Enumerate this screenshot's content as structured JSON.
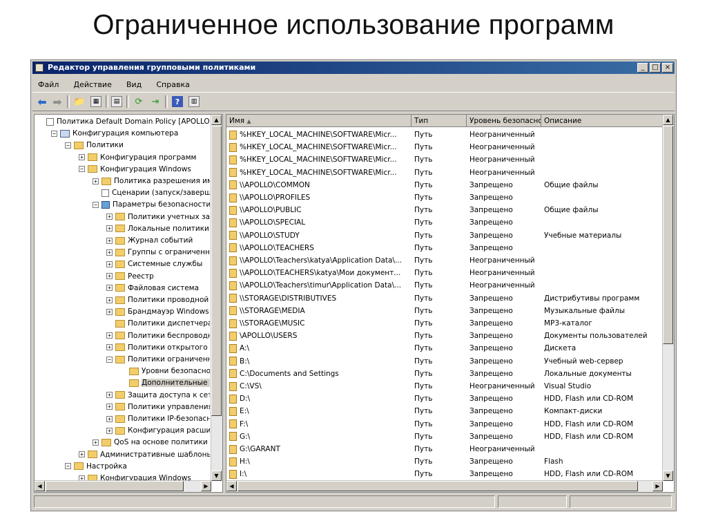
{
  "slide": {
    "title": "Ограниченное использование программ"
  },
  "window": {
    "title": "Редактор управления групповыми политиками",
    "controls": {
      "minimize": "_",
      "maximize": "□",
      "close": "×"
    }
  },
  "menu": [
    "Файл",
    "Действие",
    "Вид",
    "Справка"
  ],
  "toolbar": [
    "back-arrow-icon",
    "forward-arrow-icon",
    "up-folder-icon",
    "show-hide-tree-icon",
    "properties-icon",
    "refresh-icon",
    "export-list-icon",
    "help-icon",
    "view-icon"
  ],
  "tree": [
    {
      "label": "Политика Default Domain Policy [APOLLO.GOV",
      "icon": "doc",
      "indent": 0,
      "expander": ""
    },
    {
      "label": "Конфигурация компьютера",
      "icon": "pc",
      "indent": 1,
      "expander": "−"
    },
    {
      "label": "Политики",
      "icon": "folder",
      "indent": 2,
      "expander": "−"
    },
    {
      "label": "Конфигурация программ",
      "icon": "folder",
      "indent": 3,
      "expander": "+"
    },
    {
      "label": "Конфигурация Windows",
      "icon": "folder",
      "indent": 3,
      "expander": "−"
    },
    {
      "label": "Политика разрешения имен",
      "icon": "folder",
      "indent": 4,
      "expander": "+"
    },
    {
      "label": "Сценарии (запуск/завершение)",
      "icon": "doc",
      "indent": 4,
      "expander": ""
    },
    {
      "label": "Параметры безопасности",
      "icon": "shield",
      "indent": 4,
      "expander": "−"
    },
    {
      "label": "Политики учетных записей",
      "icon": "folder",
      "indent": 5,
      "expander": "+"
    },
    {
      "label": "Локальные политики",
      "icon": "folder",
      "indent": 5,
      "expander": "+"
    },
    {
      "label": "Журнал событий",
      "icon": "folder",
      "indent": 5,
      "expander": "+"
    },
    {
      "label": "Группы с ограниченным доступом",
      "icon": "folder",
      "indent": 5,
      "expander": "+"
    },
    {
      "label": "Системные службы",
      "icon": "folder",
      "indent": 5,
      "expander": "+"
    },
    {
      "label": "Реестр",
      "icon": "folder",
      "indent": 5,
      "expander": "+"
    },
    {
      "label": "Файловая система",
      "icon": "folder",
      "indent": 5,
      "expander": "+"
    },
    {
      "label": "Политики проводной сети",
      "icon": "folder",
      "indent": 5,
      "expander": "+"
    },
    {
      "label": "Брандмауэр Windows в режиме",
      "icon": "folder",
      "indent": 5,
      "expander": "+"
    },
    {
      "label": "Политики диспетчера списка",
      "icon": "folder",
      "indent": 5,
      "expander": ""
    },
    {
      "label": "Политики беспроводной сети",
      "icon": "folder",
      "indent": 5,
      "expander": "+"
    },
    {
      "label": "Политики открытого ключа",
      "icon": "folder",
      "indent": 5,
      "expander": "+"
    },
    {
      "label": "Политики ограниченного использования",
      "icon": "folder",
      "indent": 5,
      "expander": "−"
    },
    {
      "label": "Уровни безопасности",
      "icon": "folder",
      "indent": 6,
      "expander": ""
    },
    {
      "label": "Дополнительные правила",
      "icon": "folder",
      "indent": 6,
      "expander": "",
      "selected": true
    },
    {
      "label": "Защита доступа к сети",
      "icon": "folder",
      "indent": 5,
      "expander": "+"
    },
    {
      "label": "Политики управления приложениями",
      "icon": "folder",
      "indent": 5,
      "expander": "+"
    },
    {
      "label": "Политики IP-безопасности",
      "icon": "folder",
      "indent": 5,
      "expander": "+"
    },
    {
      "label": "Конфигурация расширенной",
      "icon": "folder",
      "indent": 5,
      "expander": "+"
    },
    {
      "label": "QoS на основе политики",
      "icon": "folder",
      "indent": 4,
      "expander": "+"
    },
    {
      "label": "Административные шаблоны:",
      "icon": "folder",
      "indent": 3,
      "expander": "+"
    },
    {
      "label": "Настройка",
      "icon": "folder",
      "indent": 2,
      "expander": "−"
    },
    {
      "label": "Конфигурация Windows",
      "icon": "folder",
      "indent": 3,
      "expander": "+"
    }
  ],
  "list": {
    "columns": [
      "Имя",
      "Тип",
      "Уровень безопасности",
      "Описание"
    ],
    "rows": [
      {
        "name": "%HKEY_LOCAL_MACHINE\\SOFTWARE\\Micr...",
        "type": "Путь",
        "level": "Неограниченный",
        "desc": ""
      },
      {
        "name": "%HKEY_LOCAL_MACHINE\\SOFTWARE\\Micr...",
        "type": "Путь",
        "level": "Неограниченный",
        "desc": ""
      },
      {
        "name": "%HKEY_LOCAL_MACHINE\\SOFTWARE\\Micr...",
        "type": "Путь",
        "level": "Неограниченный",
        "desc": ""
      },
      {
        "name": "%HKEY_LOCAL_MACHINE\\SOFTWARE\\Micr...",
        "type": "Путь",
        "level": "Неограниченный",
        "desc": ""
      },
      {
        "name": "\\\\APOLLO\\COMMON",
        "type": "Путь",
        "level": "Запрещено",
        "desc": "Общие файлы"
      },
      {
        "name": "\\\\APOLLO\\PROFILES",
        "type": "Путь",
        "level": "Запрещено",
        "desc": ""
      },
      {
        "name": "\\\\APOLLO\\PUBLIC",
        "type": "Путь",
        "level": "Запрещено",
        "desc": "Общие файлы"
      },
      {
        "name": "\\\\APOLLO\\SPECIAL",
        "type": "Путь",
        "level": "Запрещено",
        "desc": ""
      },
      {
        "name": "\\\\APOLLO\\STUDY",
        "type": "Путь",
        "level": "Запрещено",
        "desc": "Учебные материалы"
      },
      {
        "name": "\\\\APOLLO\\TEACHERS",
        "type": "Путь",
        "level": "Запрещено",
        "desc": ""
      },
      {
        "name": "\\\\APOLLO\\Teachers\\katya\\Application Data\\...",
        "type": "Путь",
        "level": "Неограниченный",
        "desc": ""
      },
      {
        "name": "\\\\APOLLO\\TEACHERS\\katya\\Мои документ...",
        "type": "Путь",
        "level": "Неограниченный",
        "desc": ""
      },
      {
        "name": "\\\\APOLLO\\Teachers\\timur\\Application Data\\...",
        "type": "Путь",
        "level": "Неограниченный",
        "desc": ""
      },
      {
        "name": "\\\\STORAGE\\DISTRIBUTIVES",
        "type": "Путь",
        "level": "Запрещено",
        "desc": "Дистрибутивы программ"
      },
      {
        "name": "\\\\STORAGE\\MEDIA",
        "type": "Путь",
        "level": "Запрещено",
        "desc": "Музыкальные файлы"
      },
      {
        "name": "\\\\STORAGE\\MUSIC",
        "type": "Путь",
        "level": "Запрещено",
        "desc": "MP3-каталог"
      },
      {
        "name": "\\APOLLO\\USERS",
        "type": "Путь",
        "level": "Запрещено",
        "desc": "Документы пользователей"
      },
      {
        "name": "A:\\",
        "type": "Путь",
        "level": "Запрещено",
        "desc": "Дискета"
      },
      {
        "name": "B:\\",
        "type": "Путь",
        "level": "Запрещено",
        "desc": "Учебный web-сервер"
      },
      {
        "name": "C:\\Documents and Settings",
        "type": "Путь",
        "level": "Запрещено",
        "desc": "Локальные документы"
      },
      {
        "name": "C:\\VS\\",
        "type": "Путь",
        "level": "Неограниченный",
        "desc": "Visual Studio"
      },
      {
        "name": "D:\\",
        "type": "Путь",
        "level": "Запрещено",
        "desc": "HDD, Flash или CD-ROM"
      },
      {
        "name": "E:\\",
        "type": "Путь",
        "level": "Запрещено",
        "desc": "Компакт-диски"
      },
      {
        "name": "F:\\",
        "type": "Путь",
        "level": "Запрещено",
        "desc": "HDD, Flash или CD-ROM"
      },
      {
        "name": "G:\\",
        "type": "Путь",
        "level": "Запрещено",
        "desc": "HDD, Flash или CD-ROM"
      },
      {
        "name": "G:\\GARANT",
        "type": "Путь",
        "level": "Неограниченный",
        "desc": ""
      },
      {
        "name": "H:\\",
        "type": "Путь",
        "level": "Запрещено",
        "desc": "Flash"
      },
      {
        "name": "I:\\",
        "type": "Путь",
        "level": "Запрещено",
        "desc": "HDD, Flash или CD-ROM"
      }
    ]
  }
}
